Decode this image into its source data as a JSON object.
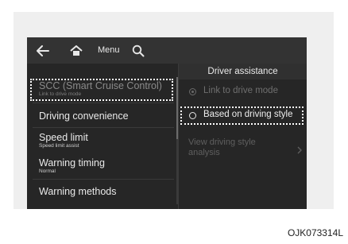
{
  "topbar": {
    "back_icon": "arrow-left-icon",
    "home_icon": "home-icon",
    "menu_label": "Menu",
    "search_icon": "search-icon"
  },
  "left_menu": {
    "items": [
      {
        "label": "SCC (Smart Cruise Control)",
        "sub": "Link to drive mode",
        "highlighted": true,
        "dimmed": true
      },
      {
        "label": "Driving convenience",
        "sub": ""
      },
      {
        "label": "Speed limit",
        "sub": "Speed limit assist"
      },
      {
        "label": "Warning timing",
        "sub": "Normal"
      },
      {
        "label": "Warning methods",
        "sub": ""
      }
    ]
  },
  "right_panel": {
    "header": "Driver assistance",
    "options": [
      {
        "label": "Link to drive mode",
        "selected": true,
        "dimmed": true
      },
      {
        "label": "Based on driving style",
        "selected": false,
        "highlighted": true
      }
    ],
    "analysis_line1": "View driving style",
    "analysis_line2": "analysis"
  },
  "caption": "OJK073314L",
  "colors": {
    "screen_bg": "#262626",
    "topbar_bg": "#333333",
    "highlight_border": "#ffffff",
    "dim_text": "#8a8a8a"
  }
}
